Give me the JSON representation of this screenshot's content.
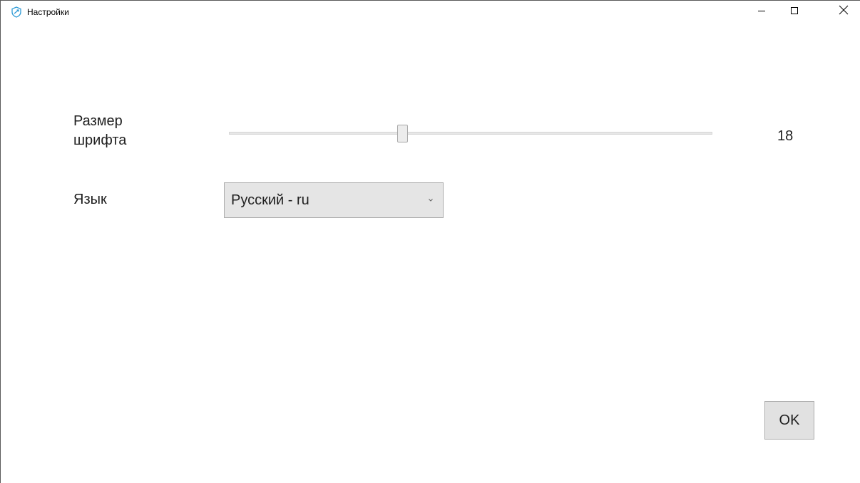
{
  "window": {
    "title": "Настройки",
    "app_icon": "app-shield-icon",
    "controls": {
      "minimize_icon": "minimize-icon",
      "maximize_icon": "maximize-icon",
      "close_icon": "close-icon"
    }
  },
  "settings": {
    "font_size": {
      "label": "Размер шрифта",
      "value": "18",
      "slider_fraction": 0.36
    },
    "language": {
      "label": "Язык",
      "selected": "Русский - ru",
      "dropdown_icon": "chevron-down-icon"
    }
  },
  "actions": {
    "ok_label": "OK"
  },
  "colors": {
    "accent": "#2f9bd6",
    "button_bg": "#e1e1e1",
    "combo_bg": "#e5e5e5"
  }
}
